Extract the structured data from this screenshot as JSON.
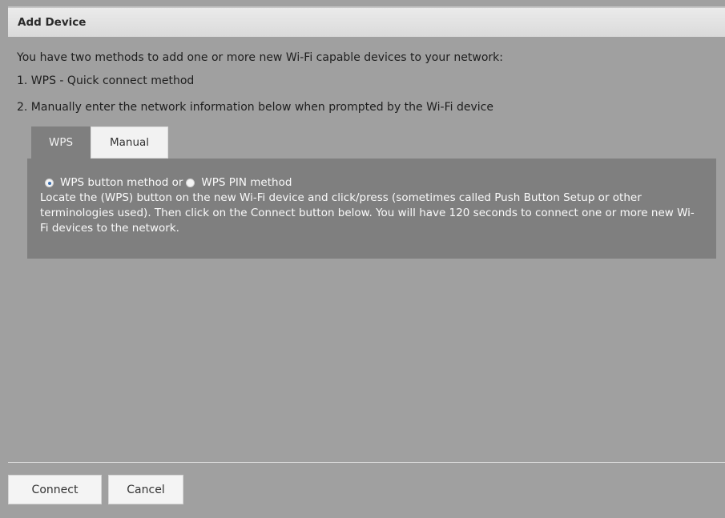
{
  "dialog": {
    "title": "Add Device",
    "intro": "You have two methods to add one or more new Wi-Fi capable devices to your network:",
    "method1": "1. WPS - Quick connect method",
    "method2": "2. Manually enter the network information below when prompted by the Wi-Fi device"
  },
  "tabs": [
    {
      "label": "WPS",
      "active": true
    },
    {
      "label": "Manual",
      "active": false
    }
  ],
  "wps_panel": {
    "option_button_label": "WPS button method or",
    "option_pin_label": "WPS PIN method",
    "selected_option": "WPS button method",
    "description": "Locate the (WPS) button on the new Wi-Fi device and click/press (sometimes called Push Button Setup or other terminologies used). Then click on the Connect button below. You will have 120 seconds to connect one or more new Wi-Fi devices to the network."
  },
  "footer": {
    "connect_label": "Connect",
    "cancel_label": "Cancel"
  },
  "colors": {
    "background": "#a0a0a0",
    "panel": "#7f7f7f",
    "titlebar": "#e3e3e3",
    "radio_selected": "#3a6fb0"
  }
}
